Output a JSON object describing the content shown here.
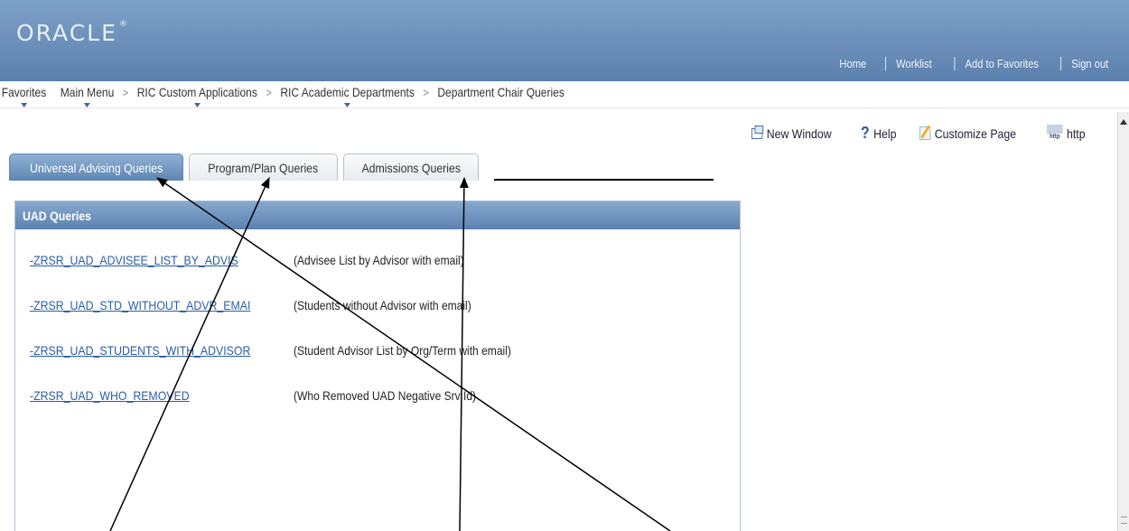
{
  "header": {
    "logo": "ORACLE",
    "links": [
      "Home",
      "Worklist",
      "Add to Favorites",
      "Sign out"
    ]
  },
  "nav": {
    "items": [
      "Favorites",
      "Main Menu",
      "RIC Custom Applications",
      "RIC Academic Departments",
      "Department Chair Queries"
    ],
    "separator": ">"
  },
  "toolbar": {
    "new_window": "New Window",
    "help": "Help",
    "customize": "Customize Page",
    "http": "http",
    "http_icon_text": "http"
  },
  "tabs": [
    "Universal Advising Queries",
    "Program/Plan Queries",
    "Admissions Queries"
  ],
  "box": {
    "title": "UAD Queries",
    "queries": [
      {
        "link": "-ZRSR_UAD_ADVISEE_LIST_BY_ADVIS",
        "desc": "(Advisee List by Advisor with email)"
      },
      {
        "link": "-ZRSR_UAD_STD_WITHOUT_ADVR_EMAI",
        "desc": "(Students without Advisor with email)"
      },
      {
        "link": "-ZRSR_UAD_STUDENTS_WITH_ADVISOR",
        "desc": "(Student Advisor List by Org/Term with email)"
      },
      {
        "link": "-ZRSR_UAD_WHO_REMOVED",
        "desc": "(Who Removed UAD Negative Srv Id)"
      }
    ]
  },
  "colors": {
    "header": "#6d92bd",
    "active_tab": "#6f95c0",
    "link": "#2a5da8"
  }
}
